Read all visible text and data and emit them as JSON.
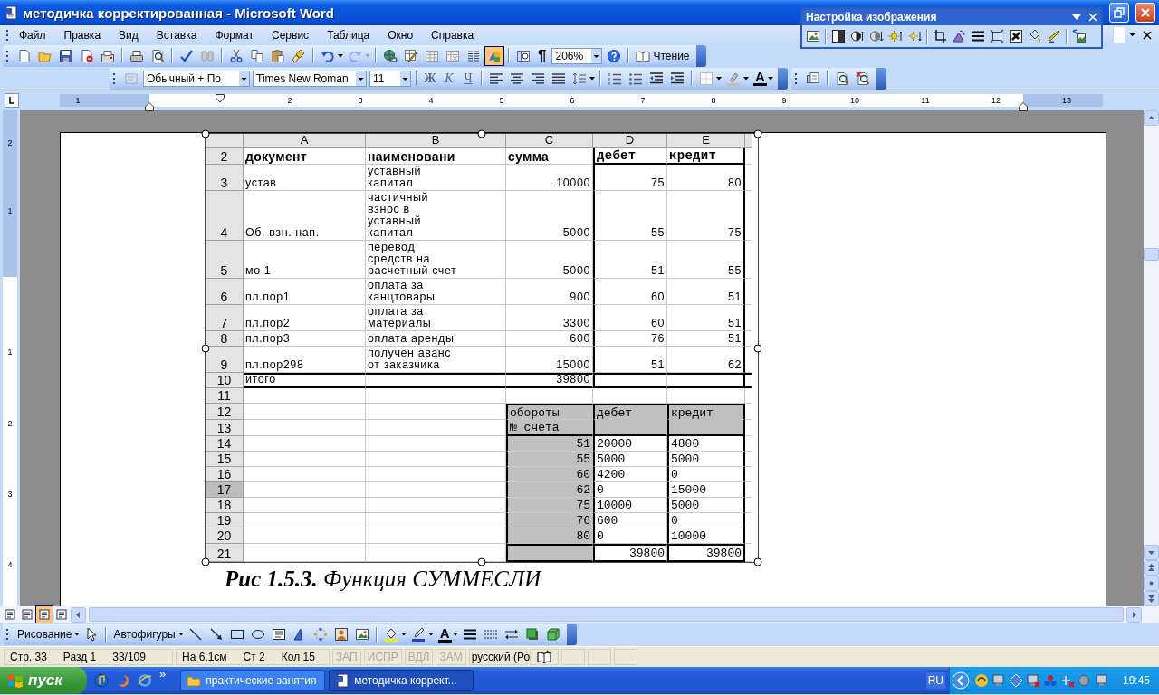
{
  "window": {
    "title": "методичка корректированная - Microsoft Word"
  },
  "menu": [
    "Файл",
    "Правка",
    "Вид",
    "Вставка",
    "Формат",
    "Сервис",
    "Таблица",
    "Окно",
    "Справка"
  ],
  "standard_toolbar": {
    "drawing_on": true,
    "redo_enabled": false,
    "marks_glyph": "¶",
    "zoom": "206%",
    "reading": "Чтение"
  },
  "formatting_toolbar": {
    "style": "Обычный + По",
    "font": "Times New Roman",
    "size": "11",
    "bold": "Ж",
    "italic": "К",
    "underline": "Ч",
    "font_color_glyph": "A"
  },
  "picture_toolbar": {
    "title": "Настройка изображения"
  },
  "ruler": {
    "labels": [
      "1",
      "2",
      "3",
      "4",
      "5",
      "6",
      "7",
      "8",
      "9",
      "10",
      "11",
      "12",
      "13"
    ]
  },
  "vertical_ruler": {
    "labels": [
      "2",
      "1",
      "1",
      "2",
      "3",
      "4"
    ]
  },
  "sheet": {
    "columns": [
      "A",
      "B",
      "C",
      "D",
      "E"
    ],
    "rows": [
      {
        "num": "2",
        "kind": "header",
        "selected": false,
        "cells": {
          "A": "документ",
          "B": "наименовани",
          "C": "сумма",
          "D": "дебет",
          "E": "кредит"
        }
      },
      {
        "num": "3",
        "kind": "data",
        "selected": false,
        "cells": {
          "A": "устав",
          "B": "уставный\nкапитал",
          "C": "10000",
          "D": "75",
          "E": "80"
        }
      },
      {
        "num": "4",
        "kind": "data",
        "selected": false,
        "cells": {
          "A": "Об. взн. нап.",
          "B": "частичный\nвзнос в\nуставный\nкапитал",
          "C": "5000",
          "D": "55",
          "E": "75"
        }
      },
      {
        "num": "5",
        "kind": "data",
        "selected": false,
        "cells": {
          "A": "мо 1",
          "B": "перевод\nсредств на\nрасчетный счет",
          "C": "5000",
          "D": "51",
          "E": "55"
        }
      },
      {
        "num": "6",
        "kind": "data",
        "selected": false,
        "cells": {
          "A": "пл.пор1",
          "B": "оплата за\nканцтовары",
          "C": "900",
          "D": "60",
          "E": "51"
        }
      },
      {
        "num": "7",
        "kind": "data",
        "selected": false,
        "cells": {
          "A": "пл.пор2",
          "B": "оплата за\nматериалы",
          "C": "3300",
          "D": "60",
          "E": "51"
        }
      },
      {
        "num": "8",
        "kind": "data",
        "selected": false,
        "cells": {
          "A": "пл.пор3",
          "B": "оплата аренды",
          "C": "600",
          "D": "76",
          "E": "51"
        }
      },
      {
        "num": "9",
        "kind": "data",
        "selected": false,
        "cells": {
          "A": "пл.пор298",
          "B": "получен аванс\nот заказчика",
          "C": "15000",
          "D": "51",
          "E": "62"
        }
      },
      {
        "num": "10",
        "kind": "total",
        "selected": false,
        "cells": {
          "A": "итого",
          "C": "39800"
        }
      },
      {
        "num": "11",
        "kind": "blank",
        "selected": false
      },
      {
        "num": "12",
        "kind": "turnover_head",
        "selected": false,
        "cells": {
          "C": "обороты",
          "D": "дебет",
          "E": "кредит"
        }
      },
      {
        "num": "13",
        "kind": "turnover_head2",
        "selected": false,
        "cells": {
          "C": "№ счета"
        }
      },
      {
        "num": "14",
        "kind": "turnover",
        "selected": false,
        "cells": {
          "C": "51",
          "D": "20000",
          "E": "4800"
        }
      },
      {
        "num": "15",
        "kind": "turnover",
        "selected": false,
        "cells": {
          "C": "55",
          "D": "5000",
          "E": "5000"
        }
      },
      {
        "num": "16",
        "kind": "turnover",
        "selected": false,
        "cells": {
          "C": "60",
          "D": "4200",
          "E": "0"
        }
      },
      {
        "num": "17",
        "kind": "turnover",
        "selected": true,
        "cells": {
          "C": "62",
          "D": "0",
          "E": "15000"
        }
      },
      {
        "num": "18",
        "kind": "turnover",
        "selected": false,
        "cells": {
          "C": "75",
          "D": "10000",
          "E": "5000"
        }
      },
      {
        "num": "19",
        "kind": "turnover",
        "selected": false,
        "cells": {
          "C": "76",
          "D": "600",
          "E": "0"
        }
      },
      {
        "num": "20",
        "kind": "turnover",
        "selected": false,
        "cells": {
          "C": "80",
          "D": "0",
          "E": "10000"
        }
      },
      {
        "num": "21",
        "kind": "turnover_total",
        "selected": false,
        "cells": {
          "D": "39800",
          "E": "39800"
        }
      }
    ]
  },
  "document": {
    "caption": "**Рис 1.5.3.** Функция СУММЕСЛИ"
  },
  "view_buttons": [
    {
      "selected": false
    },
    {
      "selected": false
    },
    {
      "selected": true
    },
    {
      "selected": false
    }
  ],
  "drawing_toolbar": {
    "drawing": "Рисование",
    "autoshapes": "Автофигуры",
    "font_color_glyph": "A"
  },
  "status_bar": {
    "fields": [
      "Стр. 33",
      "Разд 1",
      "33/109",
      "На 6,1см",
      "Ст 2",
      "Кол 15"
    ],
    "modes": [
      {
        "label": "ЗАП",
        "on": false
      },
      {
        "label": "ИСПР",
        "on": false
      },
      {
        "label": "ВДЛ",
        "on": false
      },
      {
        "label": "ЗАМ",
        "on": false
      }
    ],
    "language": "русский (Ро"
  },
  "taskbar": {
    "start": "пуск",
    "more": "»",
    "tasks": [
      {
        "label": "практические занятия",
        "selected": false
      },
      {
        "label": "методичка коррект...",
        "selected": true
      }
    ],
    "language": "RU",
    "clock": "19:45"
  }
}
